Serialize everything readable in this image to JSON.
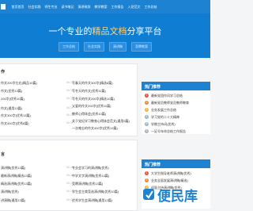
{
  "nav": {
    "items": [
      "首页首页",
      "社会实践",
      "师生专业",
      "读书笔记",
      "演讲致辞",
      "教学教案",
      "工作报告",
      "入党范文",
      "工作总结"
    ]
  },
  "hero": {
    "title_prefix": "一个专业的",
    "title_highlight": "精品文档",
    "title_suffix": "分享平台",
    "tags": [
      "工作总结",
      "社会实践",
      "演讲稿",
      "竞聘教案"
    ]
  },
  "section1": {
    "title": "作",
    "left": [
      {
        "title": "作文200字左右(精品10篇)",
        "date": "06-17"
      },
      {
        "title": "作文(优秀13篇)",
        "date": "06-17"
      },
      {
        "title": "200字(优秀10篇)",
        "date": "06-17"
      },
      {
        "title": "作文(通用13篇)",
        "date": "06-17"
      },
      {
        "title": "作文300字(优秀13篇)",
        "date": "06-17"
      },
      {
        "title": "作文400字(优秀8篇)",
        "date": "06-17"
      }
    ],
    "right": [
      {
        "title": "写春天的作文300字(精选8篇)",
        "date": "06-17"
      },
      {
        "title": "写冬天的作文(优秀11篇)",
        "date": "06-17"
      },
      {
        "title": "写冬天的作文200字(精选10篇)",
        "date": "06-17"
      },
      {
        "title": "父爱的作文200字(优秀11篇)",
        "date": "06-17"
      },
      {
        "title": "教师心得体会(优秀10篇)",
        "date": "06-17"
      },
      {
        "title": "关于党纪学习教育心得体会范文(通用5篇)",
        "date": "06-17"
      },
      {
        "title": "一次难忘的作文400字(优秀13篇)",
        "date": "06-17"
      }
    ]
  },
  "hot": {
    "title": "热门推荐",
    "items": [
      "最新党团作风学习总结",
      "最新党员教师党员教师教育",
      "业务发展工作总结",
      "学习党的二十大精神",
      "学期主持词(优秀)",
      "一证号年终总结工作报告"
    ]
  },
  "section2": {
    "title": "言",
    "left": [
      {
        "title": "演讲稿(优秀13篇)",
        "date": "06-17"
      },
      {
        "title": "最新演讲稿(精选13篇)",
        "date": "06-17"
      },
      {
        "title": "精选演讲稿(优秀13篇)",
        "date": "06-17"
      },
      {
        "title": "演讲稿(优秀)",
        "date": "06-17"
      },
      {
        "title": "讲演稿(通用13篇)",
        "date": "06-17"
      }
    ],
    "right": [
      {
        "title": "专业会学习的演讲稿(优秀)",
        "date": "06-17"
      },
      {
        "title": "中学文字演讲稿(优秀13篇)",
        "date": "06-17"
      },
      {
        "title": "竞聘演讲稿(优秀13篇)",
        "date": "06-17"
      },
      {
        "title": "学生会主席竞选演讲稿(优秀10篇)",
        "date": "06-17"
      },
      {
        "title": "优秀学生会演讲稿(通用12篇)",
        "date": "06-17"
      }
    ]
  },
  "hot2": {
    "title": "热门推荐",
    "items": [
      "大学生指导老师演讲稿(优秀)",
      "业务全面发展演讲稿(精选)",
      "迎面主持演讲稿(优秀)"
    ]
  },
  "watermark": {
    "text": "便民库"
  },
  "colors": {
    "primary": "#1d82d2",
    "hero": "#0f7ed2",
    "highlight": "#ffd37a"
  }
}
